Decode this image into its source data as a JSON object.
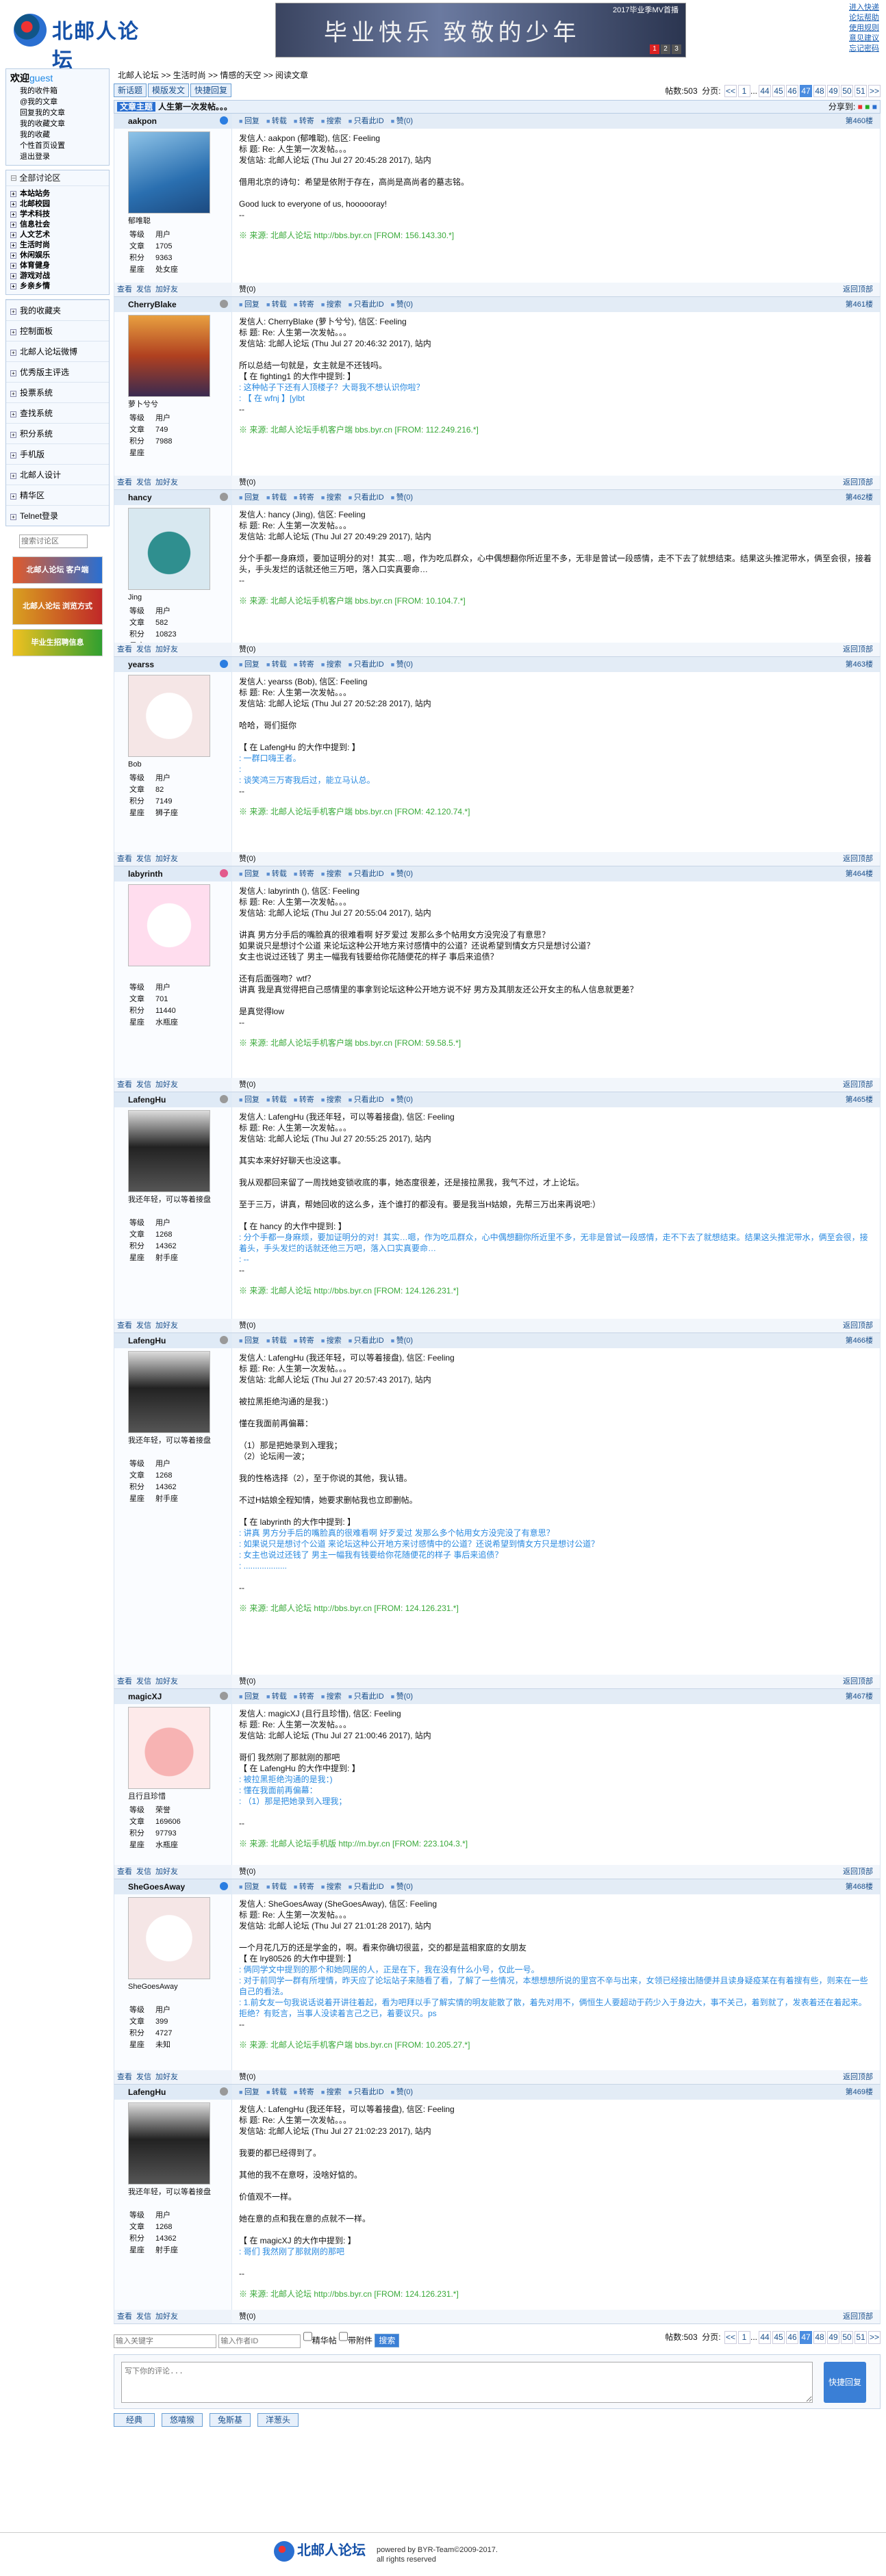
{
  "site": {
    "logo_text": "北邮人论坛",
    "banner_text": "毕业快乐 致敬的少年",
    "banner_tag": "2017毕业季MV首播",
    "banner_pages": [
      "1",
      "2",
      "3"
    ],
    "top_links": [
      "进入快递",
      "论坛帮助",
      "使用规则",
      "意见建议",
      "忘记密码"
    ]
  },
  "sidebar": {
    "greeting": "欢迎",
    "guest": "guest",
    "user_links": [
      "我的收件箱",
      "@我的文章",
      "回复我的文章",
      "我的收藏文章",
      "我的收藏",
      "个性首页设置",
      "退出登录"
    ],
    "sections_title": "全部讨论区",
    "sections": [
      "本站站务",
      "北邮校园",
      "学术科技",
      "信息社会",
      "人文艺术",
      "生活时尚",
      "休闲娱乐",
      "体育健身",
      "游戏对战",
      "乡亲乡情"
    ],
    "menu": [
      "我的收藏夹",
      "控制面板",
      "北邮人论坛微博",
      "优秀版主评选",
      "投票系统",
      "查找系统",
      "积分系统",
      "手机版",
      "北邮人设计",
      "精华区",
      "Telnet登录"
    ],
    "search_placeholder": "搜索讨论区",
    "promos": [
      "北邮人论坛 客户端",
      "北邮人论坛 浏览方式",
      "毕业生招聘信息"
    ]
  },
  "main": {
    "breadcrumb": "北邮人论坛 >> 生活时尚 >> 情感的天空 >> 阅读文章",
    "buttons": [
      "新话题",
      "模版发文",
      "快捷回复"
    ],
    "post_count": "帖数:503",
    "page_label": "分页:",
    "pages": [
      "<<",
      "1",
      "...",
      "44",
      "45",
      "46",
      "47",
      "48",
      "49",
      "50",
      "51",
      ">>"
    ],
    "current_page": "47",
    "topic_badge": "文章主题",
    "topic": "人生第一次发帖。。。",
    "share_label": "分享到:",
    "ops": [
      "回复",
      "转载",
      "转寄",
      "搜索",
      "只看此ID",
      "赞(0)"
    ],
    "foot_ops": [
      "查看",
      "发信",
      "加好友"
    ],
    "back_top": "返回顶部",
    "like": "赞(0)",
    "stat_labels": [
      "等级",
      "文章",
      "积分",
      "星座"
    ]
  },
  "posts": [
    {
      "user": "aakpon",
      "sex": "m",
      "nick": "郁唯聪",
      "level": "用户",
      "posts": "1705",
      "score": "9363",
      "star": "处女座",
      "floor": "第460楼",
      "lines": [
        "发信人: aakpon (郁唯聪), 信区: Feeling",
        "标  题: Re: 人生第一次发帖。。。",
        "发信站: 北邮人论坛 (Thu Jul 27 20:45:28 2017), 站内",
        "",
        "借用北京的诗句：希望是依附于存在，高尚是高尚者的墓志铭。",
        "",
        "Good luck to everyone of us, hoooooray!",
        "--"
      ],
      "quote": [],
      "src": "※ 来源: 北邮人论坛 http://bbs.byr.cn [FROM: 156.143.30.*]"
    },
    {
      "user": "CherryBlake",
      "sex": "n",
      "nick": "萝卜兮兮",
      "level": "用户",
      "posts": "749",
      "score": "7988",
      "star": "",
      "floor": "第461楼",
      "lines": [
        "发信人: CherryBlake (萝卜兮兮), 信区: Feeling",
        "标  题: Re: 人生第一次发帖。。。",
        "发信站: 北邮人论坛 (Thu Jul 27 20:46:32 2017), 站内",
        "",
        "所以总结一句就是，女主就是不还钱吗。",
        "【 在 fighting1 的大作中提到: 】"
      ],
      "quote": [
        ": 这种帖子下还有人顶楼子？大哥我不想认识你啦？",
        ": 【 在 wfnj 】[ylbt"
      ],
      "tail": [
        "--"
      ],
      "src": "※ 来源: 北邮人论坛手机客户端 bbs.byr.cn [FROM: 112.249.216.*]"
    },
    {
      "user": "hancy",
      "sex": "n",
      "nick": "Jing",
      "level": "用户",
      "posts": "582",
      "score": "10823",
      "star": "",
      "floor": "第462楼",
      "lines": [
        "发信人: hancy (Jing), 信区: Feeling",
        "标  题: Re: 人生第一次发帖。。。",
        "发信站: 北邮人论坛 (Thu Jul 27 20:49:29 2017), 站内",
        "",
        "分个手都一身麻烦，要加证明分的对！其实…嗯，作为吃瓜群众，心中偶想翻你所近里不多，无非是曾试一段感情，走不下去了就想结束。结果这头推泥带水，俩至会很，接着头，手头发烂的话就还他三万吧，落入口实真要命…",
        "--"
      ],
      "quote": [],
      "src": "※ 来源: 北邮人论坛手机客户端 bbs.byr.cn [FROM: 10.104.7.*]"
    },
    {
      "user": "yearss",
      "sex": "m",
      "nick": "Bob",
      "level": "用户",
      "posts": "82",
      "score": "7149",
      "star": "狮子座",
      "floor": "第463楼",
      "lines": [
        "发信人: yearss (Bob), 信区: Feeling",
        "标  题: Re: 人生第一次发帖。。。",
        "发信站: 北邮人论坛 (Thu Jul 27 20:52:28 2017), 站内",
        "",
        "哈哈，哥们挺你",
        "",
        "【 在 LafengHu 的大作中提到: 】"
      ],
      "quote": [
        ": 一群口嗨王者。",
        ":",
        ": 谈笑鸿三万寄我后过，能立马认总。"
      ],
      "tail": [
        "--"
      ],
      "src": "※ 来源: 北邮人论坛手机客户端 bbs.byr.cn [FROM: 42.120.74.*]"
    },
    {
      "user": "labyrinth",
      "sex": "f",
      "nick": "",
      "level": "用户",
      "posts": "701",
      "score": "11440",
      "star": "水瓶座",
      "floor": "第464楼",
      "lines": [
        "发信人: labyrinth (), 信区: Feeling",
        "标  题: Re: 人生第一次发帖。。。",
        "发信站: 北邮人论坛 (Thu Jul 27 20:55:04 2017), 站内",
        "",
        "讲真 男方分手后的嘴脸真的很难看啊 好歹爱过 发那么多个帖用女方没完没了有意思？",
        "如果说只是想讨个公道 来论坛这种公开地方来讨感情中的公道？还说希望到情女方只是想讨公道？",
        "女主也说过还钱了 男主一幅我有钱要给你花随便花的样子 事后来追债？",
        "",
        "还有后面强吻？wtf？",
        "讲真 我是真觉得把自己感情里的事拿到论坛这种公开地方说不好 男方及其朋友还公开女主的私人信息就更差？",
        "",
        "是真觉得low",
        "--"
      ],
      "quote": [],
      "src": "※ 来源: 北邮人论坛手机客户端 bbs.byr.cn [FROM: 59.58.5.*]"
    },
    {
      "user": "LafengHu",
      "sex": "n",
      "nick": "我还年轻，可以等着接盘",
      "level": "用户",
      "posts": "1268",
      "score": "14362",
      "star": "射手座",
      "floor": "第465楼",
      "lines": [
        "发信人: LafengHu (我还年轻，可以等着接盘), 信区: Feeling",
        "标  题: Re: 人生第一次发帖。。。",
        "发信站: 北邮人论坛 (Thu Jul 27 20:55:25 2017), 站内",
        "",
        "其实本来好好聊天也没这事。",
        "",
        "我从观都回来留了一周找她变锁收底的事，她态度很差，还是接拉黑我，我气不过，才上论坛。",
        "",
        "至于三万，讲真，帮她回收的这么多，连个谁打的都没有。要是我当H姑娘，先帮三万出来再说吧:）",
        "",
        "【 在 hancy 的大作中提到: 】"
      ],
      "quote": [
        ": 分个手都一身麻烦，要加证明分的对！其实…嗯，作为吃瓜群众，心中偶想翻你所近里不多，无非是曾试一段感情，走不下去了就想结束。结果这头推泥带水，俩至会很，接着头，手头发烂的话就还他三万吧，落入口实真要命…",
        ": --"
      ],
      "tail": [
        "--"
      ],
      "src": "※ 来源: 北邮人论坛 http://bbs.byr.cn [FROM: 124.126.231.*]"
    },
    {
      "user": "LafengHu",
      "sex": "n",
      "nick": "我还年轻，可以等着接盘",
      "level": "用户",
      "posts": "1268",
      "score": "14362",
      "star": "射手座",
      "floor": "第466楼",
      "lines": [
        "发信人: LafengHu (我还年轻，可以等着接盘), 信区: Feeling",
        "标  题: Re: 人生第一次发帖。。。",
        "发信站: 北邮人论坛 (Thu Jul 27 20:57:43 2017), 站内",
        "",
        "被拉黑拒绝沟通的是我：)",
        "",
        "懂在我面前再偏幕：",
        "",
        "（1）那是把她录到入理我；",
        "（2）论坛闹一波；",
        "",
        "我的性格选择（2），至于你说的其他，我认错。",
        "",
        "不过H姑娘全程知情，她要求删帖我也立即删帖。",
        "",
        "【 在 labyrinth 的大作中提到: 】"
      ],
      "quote": [
        ": 讲真 男方分手后的嘴脸真的很难看啊 好歹爱过 发那么多个帖用女方没完没了有意思？",
        ": 如果说只是想讨个公道 来论坛这种公开地方来讨感情中的公道？还说希望到情女方只是想讨公道？",
        ": 女主也说过还钱了 男主一幅我有钱要给你花随便花的样子 事后来追债？",
        ": ..................."
      ],
      "tail": [
        "",
        "--"
      ],
      "src": "※ 来源: 北邮人论坛 http://bbs.byr.cn [FROM: 124.126.231.*]"
    },
    {
      "user": "magicXJ",
      "sex": "n",
      "nick": "且行且珍惜",
      "level": "荣誉",
      "posts": "169606",
      "score": "97793",
      "star": "水瓶座",
      "floor": "第467楼",
      "lines": [
        "发信人: magicXJ (且行且珍惜), 信区: Feeling",
        "标  题: Re: 人生第一次发帖。。。",
        "发信站: 北邮人论坛 (Thu Jul 27 21:00:46 2017), 站内",
        "",
        "哥们 我然刚了那就刚的那吧",
        "【 在 LafengHu 的大作中提到: 】"
      ],
      "quote": [
        ": 被拉黑拒绝沟通的是我：)",
        ": 懂在我面前再偏幕：",
        ": （1）那是把她录到入理我；"
      ],
      "tail": [
        "",
        "--"
      ],
      "src": "※ 来源: 北邮人论坛手机版 http://m.byr.cn [FROM: 223.104.3.*]"
    },
    {
      "user": "SheGoesAway",
      "sex": "m",
      "nick": "SheGoesAway",
      "level": "用户",
      "posts": "399",
      "score": "4727",
      "star": "未知",
      "floor": "第468楼",
      "lines": [
        "发信人: SheGoesAway (SheGoesAway), 信区: Feeling",
        "标  题: Re: 人生第一次发帖。。。",
        "发信站: 北邮人论坛 (Thu Jul 27 21:01:28 2017), 站内",
        "",
        "一个月花几万的还是学金的，啊。看来你确切很蓝，交的都是蓝相家庭的女朋友",
        "【 在 lry80526 的大作中提到: 】"
      ],
      "quote": [
        ": 俩同学文中提到的那个和她同居的人，正是在下，我在没有什么小号，仅此一号。",
        ": 对于前同学一群有所埋情，昨天应了论坛站子来随看了看，了解了一些情况，本想想想所说的里宫不辛与出来，女领已经接出随便并且读身疑疫某在有着搜有些，则来在一些自己的看法。",
        ": 1.前女友一句我说话说着开讲往着起，看为吧拜以手了解实情的明友能散了散，着先对用不，俩恒生人要超动于药少入于身边大，事不关己，着到就了，发表着还在着起来。拒绝？有贬言，当事人没读着言己之已，着要议只。ps"
      ],
      "tail": [
        "--"
      ],
      "src": "※ 来源: 北邮人论坛手机客户端 bbs.byr.cn [FROM: 10.205.27.*]"
    },
    {
      "user": "LafengHu",
      "sex": "n",
      "nick": "我还年轻，可以等着接盘",
      "level": "用户",
      "posts": "1268",
      "score": "14362",
      "star": "射手座",
      "floor": "第469楼",
      "lines": [
        "发信人: LafengHu (我还年轻，可以等着接盘), 信区: Feeling",
        "标  题: Re: 人生第一次发帖。。。",
        "发信站: 北邮人论坛 (Thu Jul 27 21:02:23 2017), 站内",
        "",
        "我要的都已经得到了。",
        "",
        "其他的我不在意呀，没啥好惦的。",
        "",
        "价值观不一样。",
        "",
        "她在意的点和我在意的点就不一样。",
        "",
        "【 在 magicXJ 的大作中提到: 】"
      ],
      "quote": [
        ": 哥们 我然刚了那就刚的那吧"
      ],
      "tail": [
        "",
        "--"
      ],
      "src": "※ 来源: 北邮人论坛 http://bbs.byr.cn [FROM: 124.126.231.*]"
    }
  ],
  "bottom": {
    "search_author": "输入关键字",
    "search_placeholder2": "输入作者ID",
    "chk1": "精华帖",
    "chk2": "带附件",
    "search_btn": "搜索",
    "reply_placeholder": "写下你的评论...",
    "reply_btn": "快捷回复",
    "faces": [
      "经典",
      "悠嘻猴",
      "兔斯基",
      "洋葱头"
    ]
  },
  "footer": {
    "logo": "北邮人论坛",
    "powered": "powered by BYR-Team©2009-2017.",
    "rights": "all rights reserved"
  },
  "colors": {
    "accent": "#2a6fd1",
    "quote": "#2a8ae0",
    "source": "#39a939"
  }
}
